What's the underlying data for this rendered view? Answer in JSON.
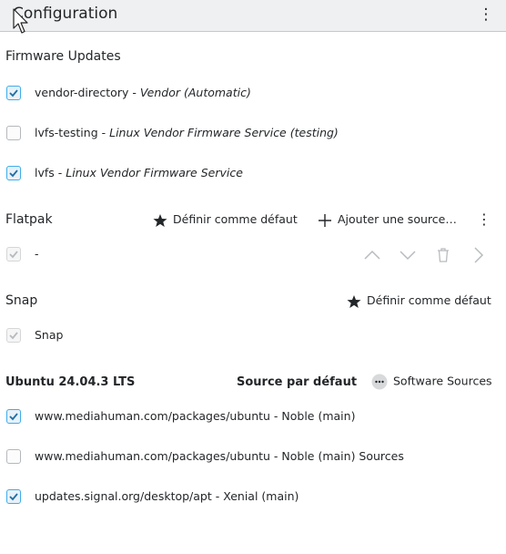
{
  "header": {
    "title": "Configuration",
    "menu_icon": "kebab-menu-icon"
  },
  "firmware": {
    "title": "Firmware Updates",
    "items": [
      {
        "name": "vendor-directory",
        "sep": " - ",
        "desc": "Vendor (Automatic)",
        "checked": true
      },
      {
        "name": "lvfs-testing",
        "sep": " - ",
        "desc": "Linux Vendor Firmware Service (testing)",
        "checked": false
      },
      {
        "name": "lvfs",
        "sep": " - ",
        "desc": "Linux Vendor Firmware Service",
        "checked": true
      }
    ]
  },
  "flatpak": {
    "title": "Flatpak",
    "default_label": "Définir comme défaut",
    "add_label": "Ajouter une source…",
    "item": {
      "name": "-",
      "checked": true,
      "disabled": true
    }
  },
  "snap": {
    "title": "Snap",
    "default_label": "Définir comme défaut",
    "item": {
      "name": "Snap",
      "checked": true,
      "disabled": true
    }
  },
  "ubuntu": {
    "title": "Ubuntu 24.04.3 LTS",
    "default_source_label": "Source par défaut",
    "software_sources_label": "Software Sources",
    "items": [
      {
        "name": "www.mediahuman.com/packages/ubuntu - Noble (main)",
        "checked": true
      },
      {
        "name": "www.mediahuman.com/packages/ubuntu - Noble (main) Sources",
        "checked": false
      },
      {
        "name": "updates.signal.org/desktop/apt - Xenial (main)",
        "checked": true
      }
    ]
  },
  "colors": {
    "accent": "#3daee9",
    "text": "#232629",
    "header_bg": "#eff0f1"
  }
}
